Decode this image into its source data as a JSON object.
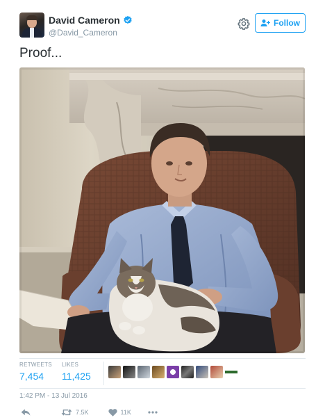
{
  "header": {
    "display_name": "David Cameron",
    "handle": "@David_Cameron",
    "follow_label": "Follow"
  },
  "tweet": {
    "text": "Proof..."
  },
  "stats": {
    "retweets_label": "RETWEETS",
    "retweets_value": "7,454",
    "likes_label": "LIKES",
    "likes_value": "11,425"
  },
  "timestamp": "1:42 PM - 13 Jul 2016",
  "actions": {
    "retweet_count": "7.5K",
    "like_count": "11K"
  },
  "icons": {
    "verified": "verified-badge-icon",
    "gear": "gear-icon",
    "follow": "add-user-icon",
    "reply": "reply-icon",
    "retweet": "retweet-icon",
    "like": "heart-icon",
    "more": "more-icon"
  },
  "colors": {
    "accent": "#1da1f2",
    "muted": "#8899a6",
    "text": "#292f33"
  }
}
